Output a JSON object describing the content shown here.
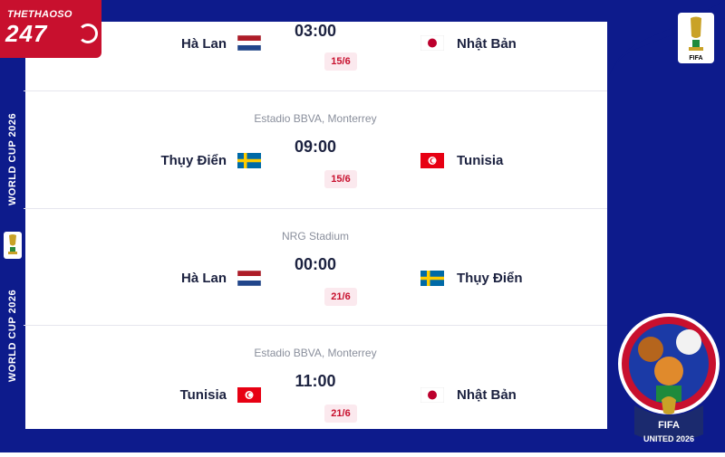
{
  "logo": {
    "line1": "THETHAOSO",
    "line2": "247"
  },
  "sidebar": {
    "vertical_text_1": "WORLD CUP 2026",
    "vertical_text_2": "WORLD CUP 2026"
  },
  "colors": {
    "navy": "#0d1b8c",
    "red": "#c8102e",
    "date_bg": "#fbe9ee",
    "text": "#1c2240",
    "muted": "#8a8f9c"
  },
  "matches": [
    {
      "venue": "",
      "home": "Hà Lan",
      "home_flag": "netherlands-flag",
      "time": "03:00",
      "away": "Nhật Bản",
      "away_flag": "japan-flag",
      "date": "15/6"
    },
    {
      "venue": "Estadio BBVA, Monterrey",
      "home": "Thụy Điển",
      "home_flag": "sweden-flag",
      "time": "09:00",
      "away": "Tunisia",
      "away_flag": "tunisia-flag",
      "date": "15/6"
    },
    {
      "venue": "NRG Stadium",
      "home": "Hà Lan",
      "home_flag": "netherlands-flag",
      "time": "00:00",
      "away": "Thụy Điển",
      "away_flag": "sweden-flag",
      "date": "21/6"
    },
    {
      "venue": "Estadio BBVA, Monterrey",
      "home": "Tunisia",
      "home_flag": "tunisia-flag",
      "time": "11:00",
      "away": "Nhật Bản",
      "away_flag": "japan-flag",
      "date": "21/6"
    }
  ],
  "badge": {
    "top": "FIFA",
    "bottom": "UNITED 2026"
  },
  "wc_logo_text": "FIFA"
}
